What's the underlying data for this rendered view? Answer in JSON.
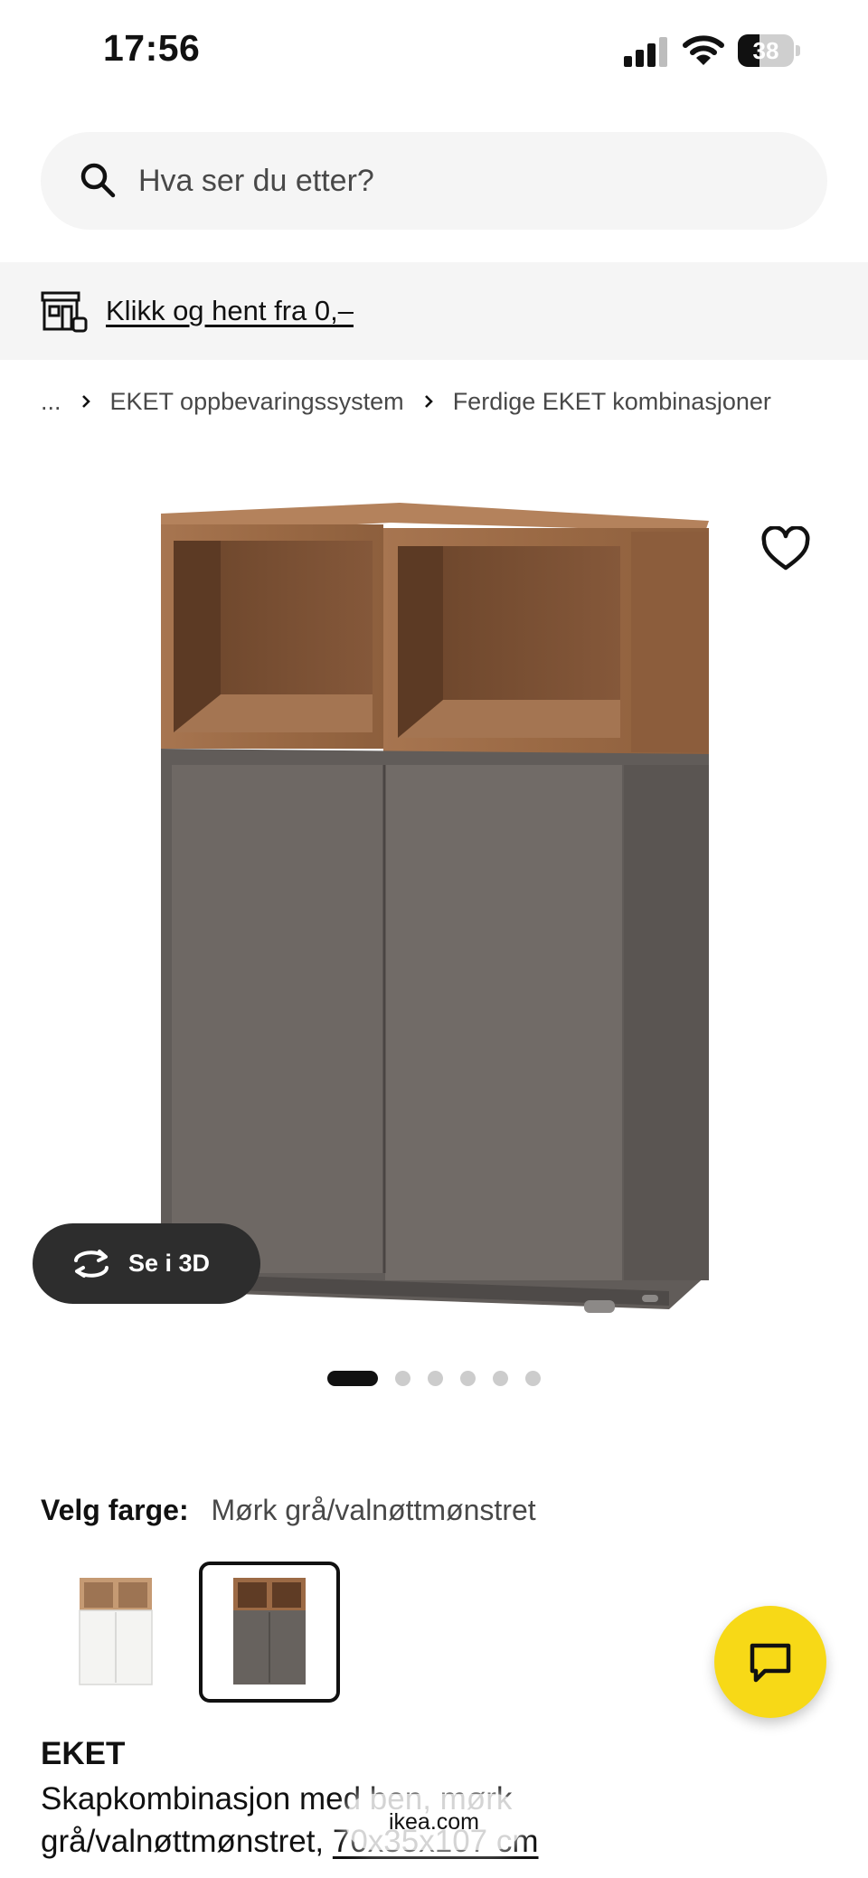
{
  "status_bar": {
    "time": "17:56",
    "battery_level": "38",
    "icons": [
      "cellular-signal-icon",
      "wifi-icon",
      "battery-icon"
    ]
  },
  "search": {
    "placeholder": "Hva ser du etter?",
    "icon": "search-icon"
  },
  "promo": {
    "icon": "store-icon",
    "link_text": "Klikk og hent fra 0,–"
  },
  "breadcrumb": {
    "items": [
      "...",
      "EKET oppbevaringssystem",
      "Ferdige EKET kombinasjoner"
    ]
  },
  "gallery": {
    "wishlist_icon": "heart-icon",
    "view_3d_label": "Se i 3D",
    "view_3d_icon": "rotate-3d-icon",
    "image_count": 6,
    "active_index": 0
  },
  "color_picker": {
    "label": "Velg farge:",
    "selected_value": "Mørk grå/valnøttmønstret",
    "options": [
      {
        "name": "white-walnut",
        "selected": false
      },
      {
        "name": "dark-grey-walnut",
        "selected": true
      }
    ]
  },
  "chat": {
    "icon": "chat-icon"
  },
  "product": {
    "name": "EKET",
    "description_line1": "Skapkombinasjon med ben, mørk",
    "description_line2": "grå/valnøttmønstret, ",
    "measurements": "70x35x107 cm"
  },
  "browser": {
    "url": "ikea.com"
  },
  "colors": {
    "brand_yellow": "#f7d917",
    "text_primary": "#111111",
    "text_secondary": "#484848",
    "surface_grey": "#f5f5f5",
    "pill_dark": "#2d2d2d",
    "cabinet_grey": "#6e6864",
    "walnut": "#9c6a45"
  }
}
